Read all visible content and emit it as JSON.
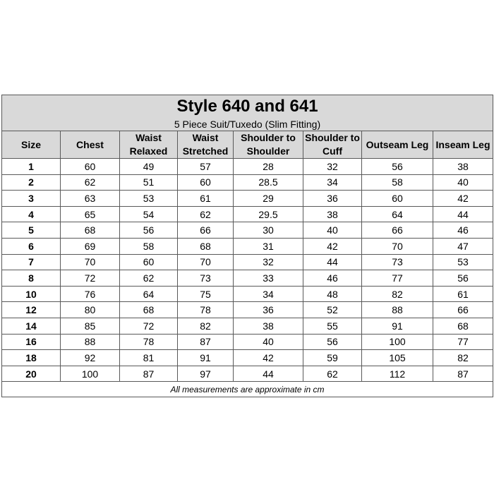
{
  "title": "Style 640 and 641",
  "subtitle": "5 Piece Suit/Tuxedo (Slim Fitting)",
  "columns": [
    [
      "Size"
    ],
    [
      "Chest"
    ],
    [
      "Waist",
      "Relaxed"
    ],
    [
      "Waist",
      "Stretched"
    ],
    [
      "Shoulder to",
      "Shoulder"
    ],
    [
      "Shoulder to",
      "Cuff"
    ],
    [
      "Outseam Leg"
    ],
    [
      "Inseam Leg"
    ]
  ],
  "rows": [
    [
      "1",
      "60",
      "49",
      "57",
      "28",
      "32",
      "56",
      "38"
    ],
    [
      "2",
      "62",
      "51",
      "60",
      "28.5",
      "34",
      "58",
      "40"
    ],
    [
      "3",
      "63",
      "53",
      "61",
      "29",
      "36",
      "60",
      "42"
    ],
    [
      "4",
      "65",
      "54",
      "62",
      "29.5",
      "38",
      "64",
      "44"
    ],
    [
      "5",
      "68",
      "56",
      "66",
      "30",
      "40",
      "66",
      "46"
    ],
    [
      "6",
      "69",
      "58",
      "68",
      "31",
      "42",
      "70",
      "47"
    ],
    [
      "7",
      "70",
      "60",
      "70",
      "32",
      "44",
      "73",
      "53"
    ],
    [
      "8",
      "72",
      "62",
      "73",
      "33",
      "46",
      "77",
      "56"
    ],
    [
      "10",
      "76",
      "64",
      "75",
      "34",
      "48",
      "82",
      "61"
    ],
    [
      "12",
      "80",
      "68",
      "78",
      "36",
      "52",
      "88",
      "66"
    ],
    [
      "14",
      "85",
      "72",
      "82",
      "38",
      "55",
      "91",
      "68"
    ],
    [
      "16",
      "88",
      "78",
      "87",
      "40",
      "56",
      "100",
      "77"
    ],
    [
      "18",
      "92",
      "81",
      "91",
      "42",
      "59",
      "105",
      "82"
    ],
    [
      "20",
      "100",
      "87",
      "97",
      "44",
      "62",
      "112",
      "87"
    ]
  ],
  "footnote": "All measurements are approximate in cm",
  "colors": {
    "header_background": "#d9d9d9",
    "border": "#595959"
  }
}
